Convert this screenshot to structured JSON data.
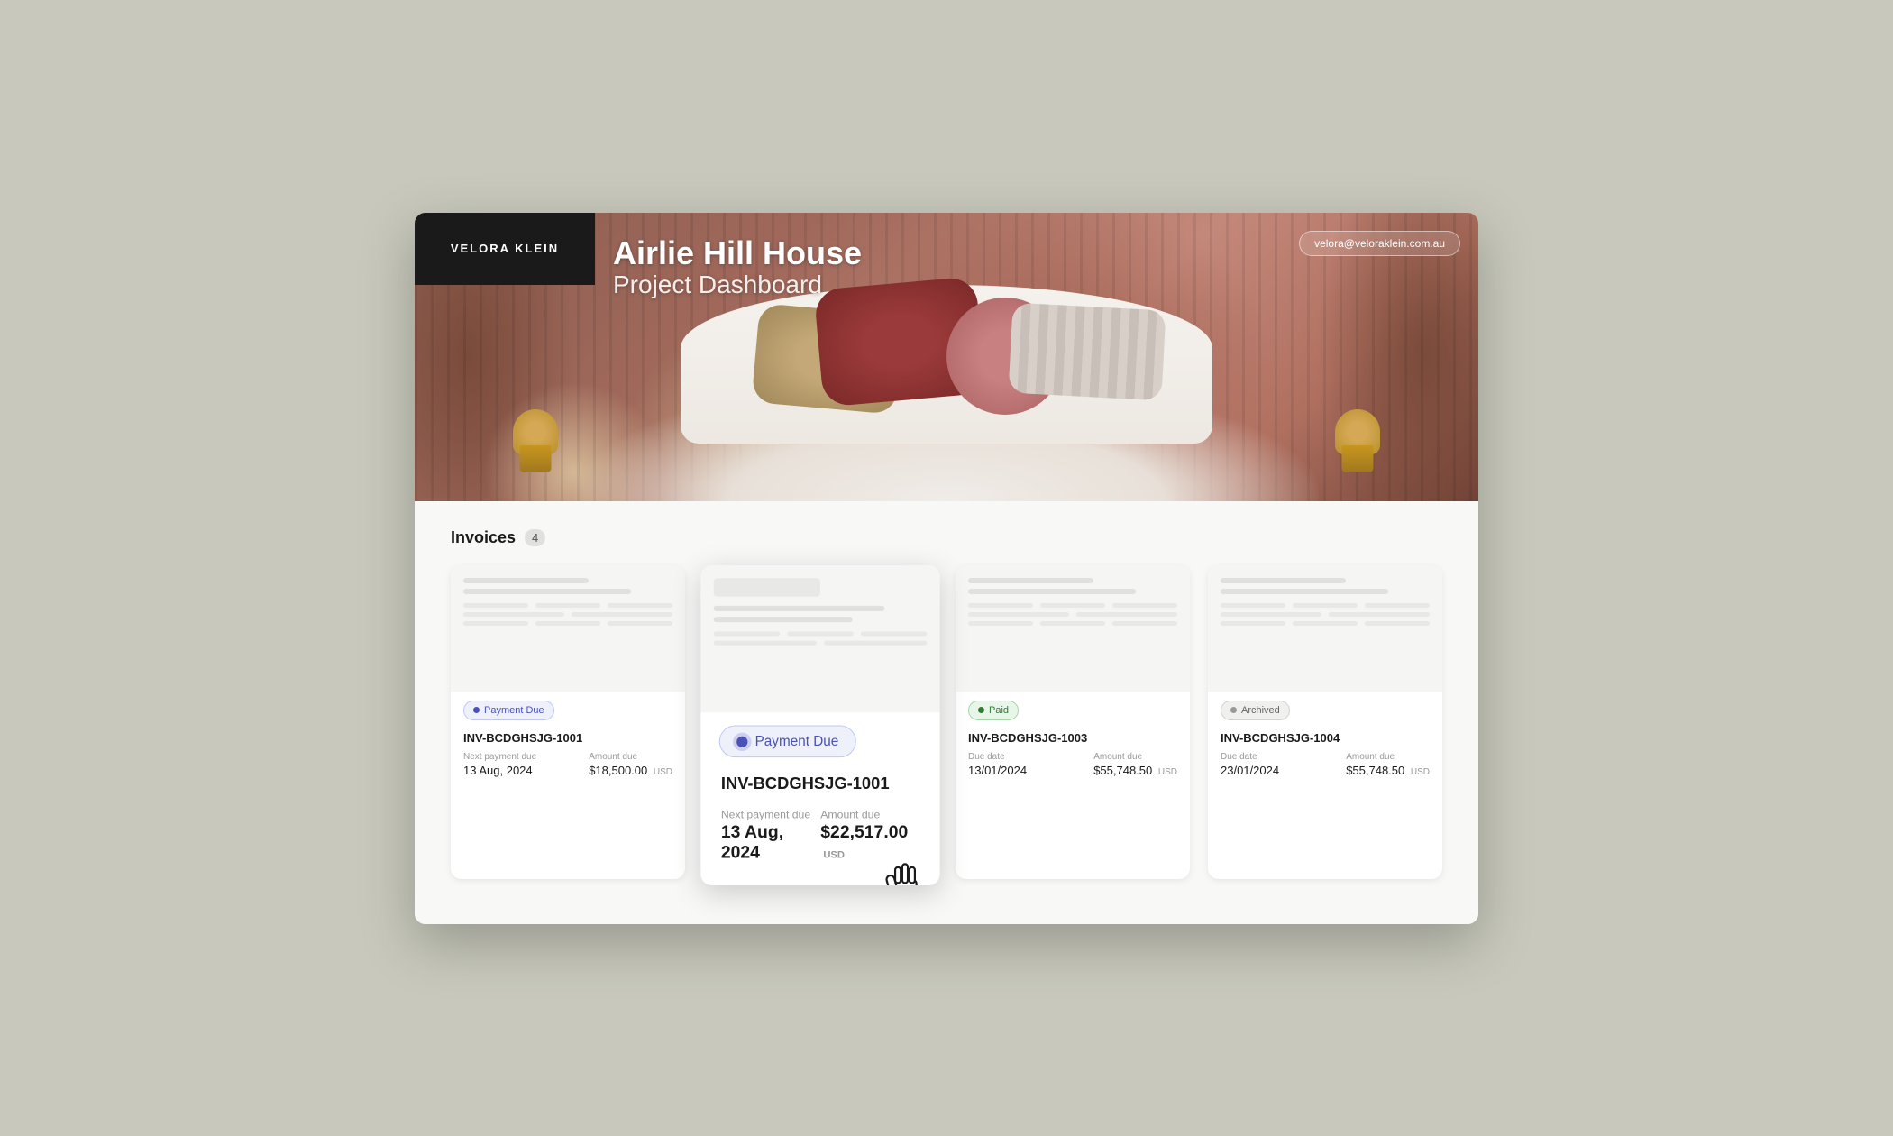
{
  "brand": {
    "logo": "VELORA KLEIN"
  },
  "hero": {
    "project_name": "Airlie Hill House",
    "dashboard_label": "Project Dashboard",
    "user_email": "velora@veloraklein.com.au"
  },
  "invoices": {
    "section_label": "Invoices",
    "count": "4",
    "cards": [
      {
        "id": "INV-BCDGHSJG-1001",
        "status": "Payment Due",
        "status_type": "payment-due",
        "date_label": "Next payment due",
        "date_value": "13 Aug, 2024",
        "amount_label": "Amount due",
        "amount_value": "$18,500.00",
        "currency": "USD"
      },
      {
        "id": "INV-BCDGHSJG-1001",
        "status": "Payment Due",
        "status_type": "payment-due",
        "date_label": "Next payment due",
        "date_value": "13 Aug, 2024",
        "amount_label": "Amount due",
        "amount_value": "$22,517.00",
        "currency": "USD",
        "expanded": true
      },
      {
        "id": "INV-BCDGHSJG-1003",
        "status": "Paid",
        "status_type": "paid",
        "date_label": "Due date",
        "date_value": "13/01/2024",
        "amount_label": "Amount due",
        "amount_value": "$55,748.50",
        "currency": "USD"
      },
      {
        "id": "INV-BCDGHSJG-1004",
        "status": "Archived",
        "status_type": "archived",
        "date_label": "Due date",
        "date_value": "23/01/2024",
        "amount_label": "Amount due",
        "amount_value": "$55,748.50",
        "currency": "USD"
      }
    ]
  }
}
